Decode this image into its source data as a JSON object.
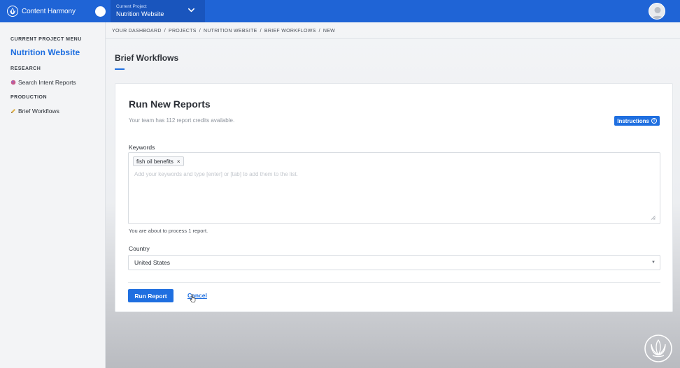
{
  "topbar": {
    "brand_name": "Content Harmony",
    "project_caption": "Current Project",
    "project_name": "Nutrition Website"
  },
  "sidebar": {
    "menu_heading": "CURRENT PROJECT MENU",
    "project_name": "Nutrition Website",
    "sections": [
      {
        "heading": "RESEARCH",
        "item": "Search Intent Reports",
        "icon": "brain-icon"
      },
      {
        "heading": "PRODUCTION",
        "item": "Brief Workflows",
        "icon": "pencil-icon"
      }
    ]
  },
  "breadcrumb": [
    "YOUR DASHBOARD",
    "PROJECTS",
    "NUTRITION WEBSITE",
    "BRIEF WORKFLOWS",
    "NEW"
  ],
  "breadcrumb_separator": "/",
  "page": {
    "title": "Brief Workflows"
  },
  "card": {
    "title": "Run New Reports",
    "credits_text": "Your team has 112 report credits available.",
    "instructions_label": "Instructions",
    "instructions_icon": "info-icon",
    "keywords_label": "Keywords",
    "keywords": [
      "fish oil benefits"
    ],
    "keyword_remove_symbol": "×",
    "keywords_placeholder": "Add your keywords and type [enter] or [tab] to add them to the list.",
    "process_hint": "You are about to process 1 report.",
    "country_label": "Country",
    "country_value": "United States",
    "run_label": "Run Report",
    "cancel_label": "Cancel"
  },
  "colors": {
    "topbar": "#1f64d6",
    "accent": "#1f6fe0",
    "sidebar_bg": "#f3f4f6"
  }
}
